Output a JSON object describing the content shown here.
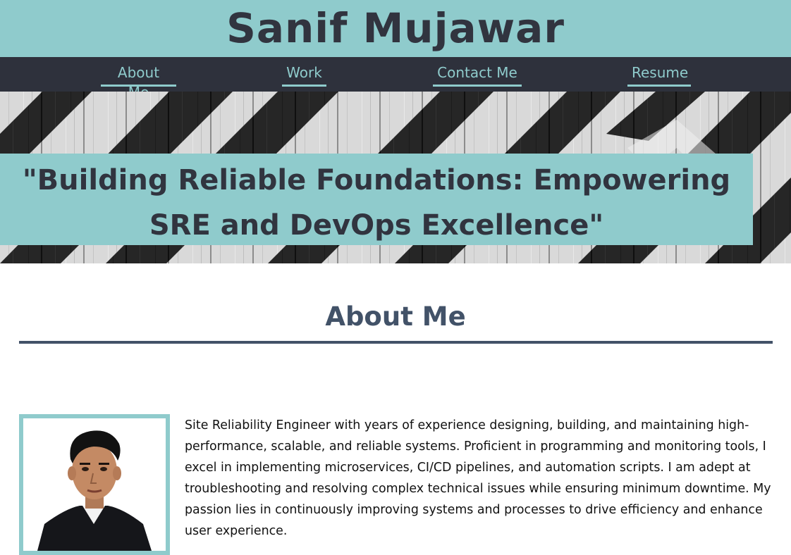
{
  "header": {
    "title": "Sanif Mujawar"
  },
  "nav": {
    "items": [
      {
        "label": "About Me"
      },
      {
        "label": "Work"
      },
      {
        "label": "Contact Me"
      },
      {
        "label": "Resume"
      }
    ]
  },
  "hero": {
    "tagline": "\"Building Reliable Foundations: Empowering SRE and DevOps Excellence\"",
    "background": "black and white striped wood planks"
  },
  "about": {
    "heading": "About Me",
    "photo_alt": "portrait photo",
    "bio": "Site Reliability Engineer with years of experience designing, building, and maintaining high-performance, scalable, and reliable systems. Proficient in programming and monitoring tools, I excel in implementing microservices, CI/CD pipelines, and automation scripts. I am adept at troubleshooting and resolving complex technical issues while ensuring minimum downtime. My passion lies in continuously improving systems and processes to drive efficiency and enhance user experience."
  },
  "colors": {
    "accent": "#8fcbcc",
    "dark": "#2e313c",
    "heading": "#425268"
  }
}
